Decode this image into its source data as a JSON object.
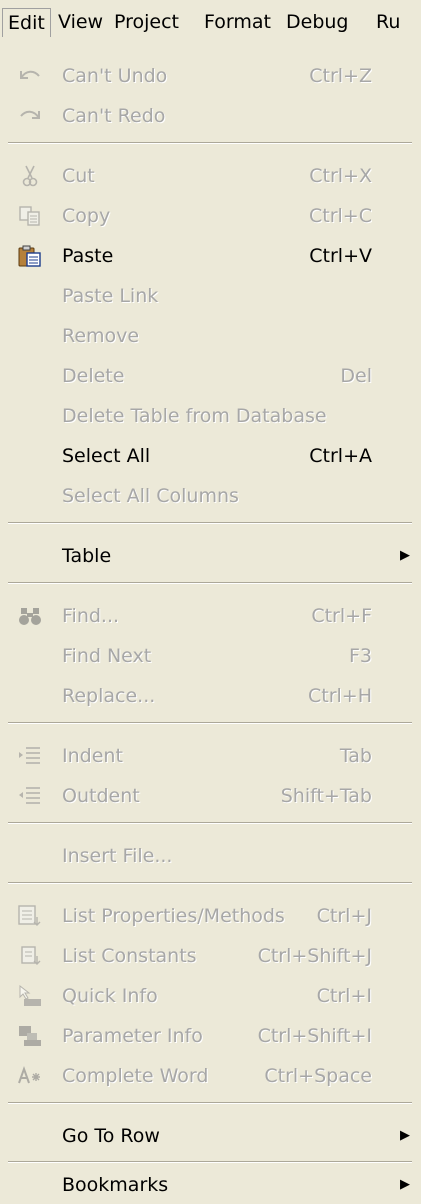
{
  "menubar": {
    "items": [
      "Edit",
      "View",
      "Project",
      "Format",
      "Debug",
      "Ru"
    ]
  },
  "menu": {
    "undo": {
      "label": "Can't Undo",
      "shortcut": "Ctrl+Z",
      "icon": "undo-arrow-icon",
      "enabled": false
    },
    "redo": {
      "label": "Can't Redo",
      "shortcut": "",
      "icon": "redo-arrow-icon",
      "enabled": false
    },
    "cut": {
      "label": "Cut",
      "shortcut": "Ctrl+X",
      "icon": "scissors-icon",
      "enabled": false
    },
    "copy": {
      "label": "Copy",
      "shortcut": "Ctrl+C",
      "icon": "copy-icon",
      "enabled": false
    },
    "paste": {
      "label": "Paste",
      "shortcut": "Ctrl+V",
      "icon": "clipboard-icon",
      "enabled": true
    },
    "paste_link": {
      "label": "Paste Link",
      "shortcut": "",
      "enabled": false
    },
    "remove": {
      "label": "Remove",
      "shortcut": "",
      "enabled": false
    },
    "delete": {
      "label": "Delete",
      "shortcut": "Del",
      "enabled": false
    },
    "delete_table": {
      "label": "Delete Table from Database",
      "shortcut": "",
      "enabled": false
    },
    "select_all": {
      "label": "Select All",
      "shortcut": "Ctrl+A",
      "enabled": true
    },
    "select_all_columns": {
      "label": "Select All Columns",
      "shortcut": "",
      "enabled": false
    },
    "table": {
      "label": "Table",
      "shortcut": "",
      "enabled": true,
      "submenu": true
    },
    "find": {
      "label": "Find...",
      "shortcut": "Ctrl+F",
      "icon": "binoculars-icon",
      "enabled": false
    },
    "find_next": {
      "label": "Find Next",
      "shortcut": "F3",
      "enabled": false
    },
    "replace": {
      "label": "Replace...",
      "shortcut": "Ctrl+H",
      "enabled": false
    },
    "indent": {
      "label": "Indent",
      "shortcut": "Tab",
      "icon": "indent-icon",
      "enabled": false
    },
    "outdent": {
      "label": "Outdent",
      "shortcut": "Shift+Tab",
      "icon": "outdent-icon",
      "enabled": false
    },
    "insert_file": {
      "label": "Insert File...",
      "shortcut": "",
      "enabled": false
    },
    "list_properties": {
      "label": "List Properties/Methods",
      "shortcut": "Ctrl+J",
      "icon": "list-properties-icon",
      "enabled": false
    },
    "list_constants": {
      "label": "List Constants",
      "shortcut": "Ctrl+Shift+J",
      "icon": "list-constants-icon",
      "enabled": false
    },
    "quick_info": {
      "label": "Quick Info",
      "shortcut": "Ctrl+I",
      "icon": "quick-info-icon",
      "enabled": false
    },
    "parameter_info": {
      "label": "Parameter Info",
      "shortcut": "Ctrl+Shift+I",
      "icon": "parameter-info-icon",
      "enabled": false
    },
    "complete_word": {
      "label": "Complete Word",
      "shortcut": "Ctrl+Space",
      "icon": "complete-word-icon",
      "enabled": false
    },
    "go_to_row": {
      "label": "Go To Row",
      "shortcut": "",
      "enabled": true,
      "submenu": true
    },
    "bookmarks": {
      "label": "Bookmarks",
      "shortcut": "",
      "enabled": true,
      "submenu": true
    }
  },
  "colors": {
    "menu_background": "#ece9d8",
    "disabled_text": "#a7a7a7",
    "enabled_text": "#000000",
    "separator": "#aca899"
  }
}
